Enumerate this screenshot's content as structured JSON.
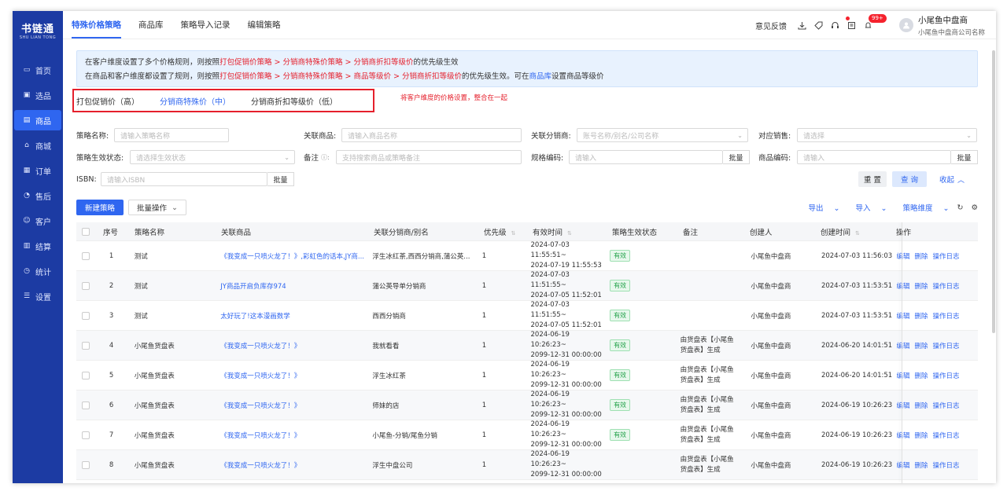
{
  "logo": {
    "cn": "书链通",
    "en": "SHU LIAN TONG"
  },
  "sidebar": {
    "items": [
      {
        "label": "首页",
        "icon": "monitor-icon"
      },
      {
        "label": "选品",
        "icon": "select-icon"
      },
      {
        "label": "商品",
        "icon": "goods-icon"
      },
      {
        "label": "商城",
        "icon": "mall-icon"
      },
      {
        "label": "订单",
        "icon": "order-icon"
      },
      {
        "label": "售后",
        "icon": "service-icon"
      },
      {
        "label": "客户",
        "icon": "customer-icon"
      },
      {
        "label": "结算",
        "icon": "settle-icon"
      },
      {
        "label": "统计",
        "icon": "stats-icon"
      },
      {
        "label": "设置",
        "icon": "settings-icon"
      }
    ],
    "active_index": 2
  },
  "header": {
    "tabs": [
      "特殊价格策略",
      "商品库",
      "策略导入记录",
      "编辑策略"
    ],
    "active_tab": 0,
    "feedback": "意见反馈",
    "badge": "99+",
    "user_name": "小尾鱼中盘商",
    "user_company": "小尾鱼中盘商公司名称"
  },
  "notice": {
    "line1_a": "在客户维度设置了多个价格规则，则按照",
    "line1_b": "打包促销价策略 > 分销商特殊价策略 > 分销商折扣等级价",
    "line1_c": "的优先级生效",
    "line2_a": "在商品和客户维度都设置了规则，则按照",
    "line2_b": "打包促销价策略 > 分销商特殊价策略 > 商品等级价 > 分销商折扣等级价",
    "line2_c": "的优先级生效。可在",
    "line2_d": "商品库",
    "line2_e": "设置商品等级价"
  },
  "priority": {
    "items": [
      "打包促销价（高）",
      "分销商特殊价（中）",
      "分销商折扣等级价（低）"
    ],
    "note": "将客户维度的价格设置，整合在一起"
  },
  "filters": {
    "name_label": "策略名称:",
    "name_ph": "请输入策略名称",
    "goods_label": "关联商品:",
    "goods_ph": "请输入商品名称",
    "dist_label": "关联分销商:",
    "dist_ph": "账号名称/别名/公司名称",
    "sales_label": "对应销售:",
    "sales_ph": "请选择",
    "status_label": "策略生效状态:",
    "status_ph": "请选择生效状态",
    "remark_label": "备注",
    "remark_ph": "支持搜索商品或策略备注",
    "spec_label": "规格编码:",
    "spec_ph": "请输入",
    "code_label": "商品编码:",
    "code_ph": "请输入",
    "isbn_label": "ISBN:",
    "isbn_ph": "请输入ISBN",
    "batch": "批量",
    "reset": "重 置",
    "query": "查 询",
    "collapse": "收起"
  },
  "toolbar": {
    "new": "新建策略",
    "batch_ops": "批量操作",
    "export": "导出",
    "import": "导入",
    "dimension": "策略维度"
  },
  "table": {
    "headers": [
      "序号",
      "策略名称",
      "关联商品",
      "关联分销商/别名",
      "优先级",
      "有效时间",
      "策略生效状态",
      "备注",
      "创建人",
      "创建时间",
      "操作"
    ],
    "actions": [
      "编辑",
      "删除",
      "操作日志"
    ],
    "rows": [
      {
        "no": "1",
        "name": "测试",
        "goods": "《我变成一只喷火龙了！》,彩虹色的话本,JY商...",
        "dist": "浮生冰红茶,西西分销商,蒲公英...",
        "prio": "1",
        "t1": "2024-07-03 11:55:51~",
        "t2": "2024-07-19 11:55:53",
        "status": "有效",
        "remark": "",
        "creator": "小尾鱼中盘商",
        "created": "2024-07-03 11:56:03"
      },
      {
        "no": "2",
        "name": "测试",
        "goods": "JY商品开启负库存974",
        "dist": "蒲公英导单分销商",
        "prio": "1",
        "t1": "2024-07-03 11:51:55~",
        "t2": "2024-07-05 11:52:01",
        "status": "有效",
        "remark": "",
        "creator": "小尾鱼中盘商",
        "created": "2024-07-03 11:53:51"
      },
      {
        "no": "3",
        "name": "测试",
        "goods": "太好玩了!这本漫画数学",
        "dist": "西西分销商",
        "prio": "1",
        "t1": "2024-07-03 11:51:55~",
        "t2": "2024-07-05 11:52:01",
        "status": "有效",
        "remark": "",
        "creator": "小尾鱼中盘商",
        "created": "2024-07-03 11:53:51"
      },
      {
        "no": "4",
        "name": "小尾鱼货盘表",
        "goods": "《我变成一只喷火龙了！》",
        "dist": "我就看看",
        "prio": "1",
        "t1": "2024-06-19 10:26:23~",
        "t2": "2099-12-31 00:00:00",
        "status": "有效",
        "remark": "由货盘表【小尾鱼货盘表】生成",
        "creator": "小尾鱼中盘商",
        "created": "2024-06-20 14:01:51"
      },
      {
        "no": "5",
        "name": "小尾鱼货盘表",
        "goods": "《我变成一只喷火龙了！》",
        "dist": "浮生冰红茶",
        "prio": "1",
        "t1": "2024-06-19 10:26:23~",
        "t2": "2099-12-31 00:00:00",
        "status": "有效",
        "remark": "由货盘表【小尾鱼货盘表】生成",
        "creator": "小尾鱼中盘商",
        "created": "2024-06-20 14:01:51"
      },
      {
        "no": "6",
        "name": "小尾鱼货盘表",
        "goods": "《我变成一只喷火龙了！》",
        "dist": "师妹的店",
        "prio": "1",
        "t1": "2024-06-19 10:26:23~",
        "t2": "2099-12-31 00:00:00",
        "status": "有效",
        "remark": "由货盘表【小尾鱼货盘表】生成",
        "creator": "小尾鱼中盘商",
        "created": "2024-06-19 10:26:23"
      },
      {
        "no": "7",
        "name": "小尾鱼货盘表",
        "goods": "《我变成一只喷火龙了！》",
        "dist": "小尾鱼-分销/尾鱼分销",
        "prio": "1",
        "t1": "2024-06-19 10:26:23~",
        "t2": "2099-12-31 00:00:00",
        "status": "有效",
        "remark": "由货盘表【小尾鱼货盘表】生成",
        "creator": "小尾鱼中盘商",
        "created": "2024-06-19 10:26:23"
      },
      {
        "no": "8",
        "name": "小尾鱼货盘表",
        "goods": "《我变成一只喷火龙了！》",
        "dist": "浮生中盘公司",
        "prio": "1",
        "t1": "2024-06-19 10:26:23~",
        "t2": "2099-12-31 00:00:00",
        "status": "",
        "remark": "由货盘表【小尾鱼货盘表】生成",
        "creator": "小尾鱼中盘商",
        "created": "2024-06-19 10:26:23"
      }
    ]
  }
}
